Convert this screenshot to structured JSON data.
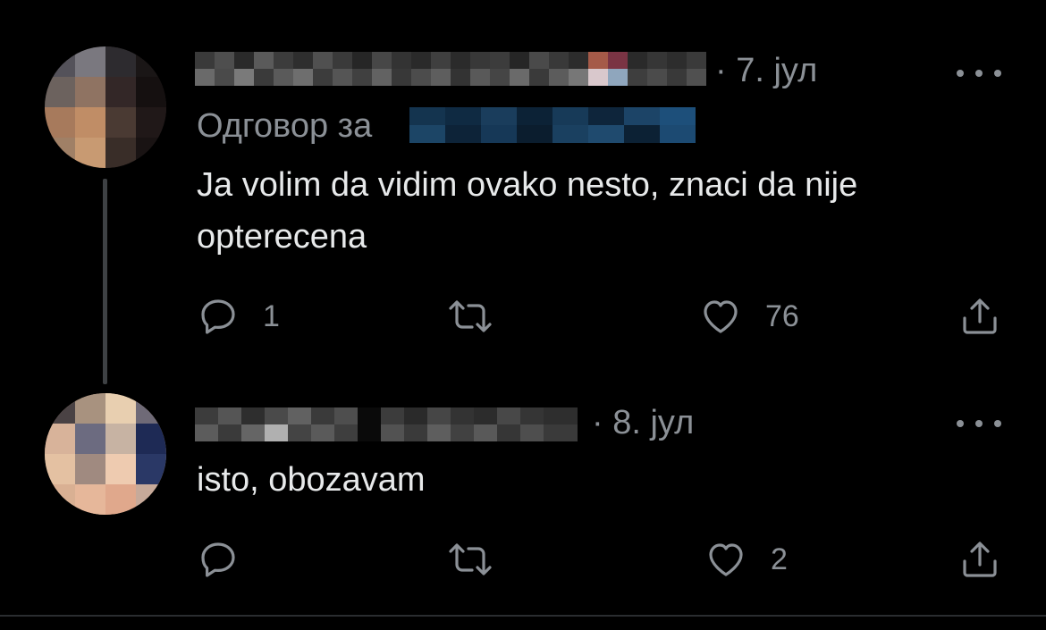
{
  "tweets": [
    {
      "date": "· 7. јул",
      "reply_prefix": "Одговор за",
      "text": "Ja volim da vidim ovako nesto, znaci da nije opterecena",
      "reply_count": "1",
      "retweet_count": "",
      "like_count": "76"
    },
    {
      "date": "· 8. јул",
      "text": "isto, obozavam",
      "reply_count": "",
      "retweet_count": "",
      "like_count": "2"
    }
  ],
  "colors": {
    "background": "#000000",
    "text": "#e7e9ea",
    "muted": "#8b9096",
    "mention_blur": "#1d4f7a",
    "divider": "#2a2d30"
  },
  "icons": [
    "reply-icon",
    "retweet-icon",
    "like-icon",
    "share-icon",
    "more-icon"
  ]
}
